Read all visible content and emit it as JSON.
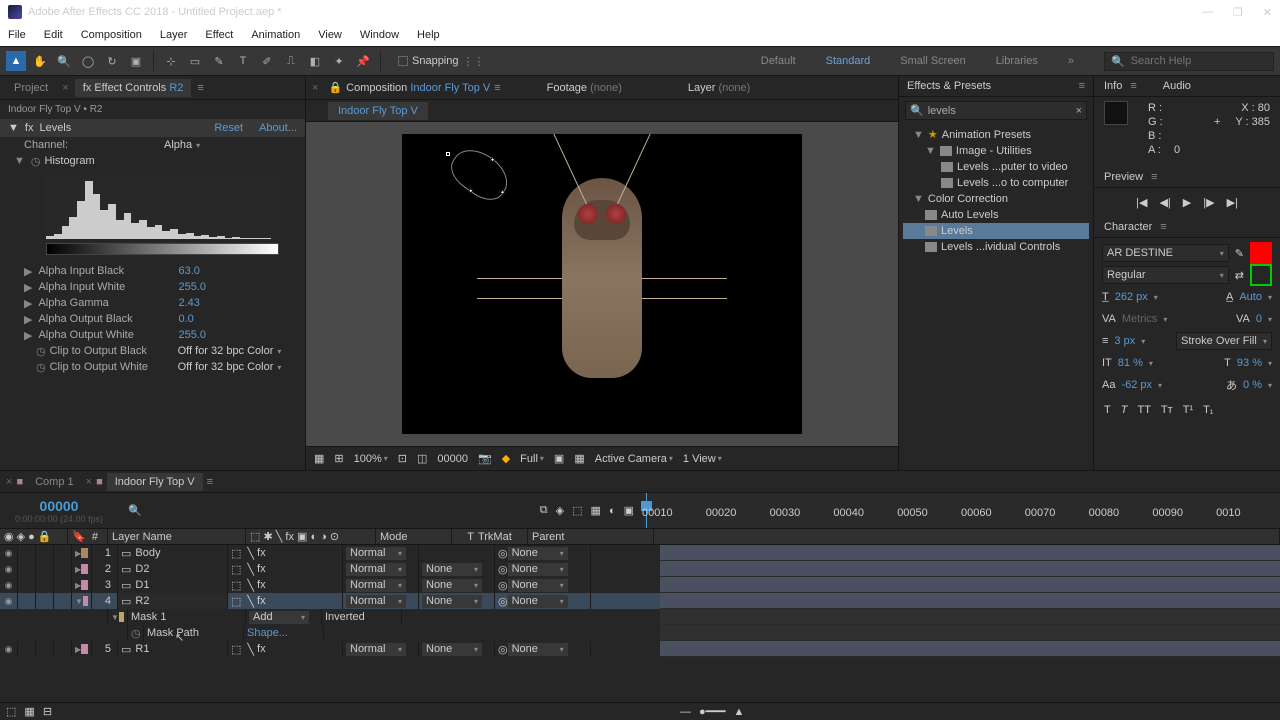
{
  "title": "Adobe After Effects CC 2018 - Untitled Project.aep *",
  "menu": [
    "File",
    "Edit",
    "Composition",
    "Layer",
    "Effect",
    "Animation",
    "View",
    "Window",
    "Help"
  ],
  "toolbar": {
    "snapping": "Snapping",
    "workspace": {
      "default": "Default",
      "standard": "Standard",
      "small": "Small Screen",
      "libs": "Libraries"
    },
    "searchPlaceholder": "Search Help"
  },
  "left": {
    "tabs": {
      "project": "Project",
      "ec": "Effect Controls",
      "ecTarget": "R2"
    },
    "path": "Indoor Fly Top V • R2",
    "fx": {
      "name": "Levels",
      "reset": "Reset",
      "about": "About...",
      "channel_lbl": "Channel:",
      "channel_val": "Alpha",
      "histogram": "Histogram"
    },
    "params": [
      {
        "lbl": "Alpha Input Black",
        "val": "63.0"
      },
      {
        "lbl": "Alpha Input White",
        "val": "255.0"
      },
      {
        "lbl": "Alpha Gamma",
        "val": "2.43"
      },
      {
        "lbl": "Alpha Output Black",
        "val": "0.0"
      },
      {
        "lbl": "Alpha Output White",
        "val": "255.0"
      }
    ],
    "clip": [
      {
        "lbl": "Clip to Output Black",
        "val": "Off for 32 bpc Color"
      },
      {
        "lbl": "Clip to Output White",
        "val": "Off for 32 bpc Color"
      }
    ]
  },
  "center": {
    "tabs": {
      "comp": "Composition",
      "compName": "Indoor Fly Top V",
      "footage": "Footage",
      "footageVal": "(none)",
      "layer": "Layer",
      "layerVal": "(none)"
    },
    "subtab": "Indoor Fly Top V",
    "ctrl": {
      "zoom": "100%",
      "time": "00000",
      "res": "Full",
      "cam": "Active Camera",
      "view": "1 View"
    }
  },
  "ep": {
    "title": "Effects & Presets",
    "search": "levels",
    "nodes": {
      "ap": "Animation Presets",
      "iu": "Image - Utilities",
      "l1": "Levels ...puter to video",
      "l2": "Levels ...o to computer",
      "cc": "Color Correction",
      "al": "Auto Levels",
      "lv": "Levels",
      "lic": "Levels ...ividual Controls"
    }
  },
  "info": {
    "title": "Info",
    "audio": "Audio",
    "r": "R :",
    "g": "G :",
    "b": "B :",
    "a": "A :",
    "aval": "0",
    "x": "X : 80",
    "y": "Y : 385",
    "plus": "+"
  },
  "preview": {
    "title": "Preview"
  },
  "char": {
    "title": "Character",
    "font": "AR DESTINE",
    "weight": "Regular",
    "size": "262 px",
    "auto": "Auto",
    "kerning": "0",
    "leading": "3 px",
    "stroke": "Stroke Over Fill",
    "vscale": "81 %",
    "hscale": "93 %",
    "baseline": "-62 px",
    "tsume": "0 %"
  },
  "tl": {
    "tabs": {
      "comp1": "Comp 1",
      "fly": "Indoor Fly Top V"
    },
    "timecode": "00000",
    "sub": "0:00:00:00 (24.00 fps)",
    "cols": {
      "num": "#",
      "name": "Layer Name",
      "mode": "Mode",
      "trk": "TrkMat",
      "parent": "Parent"
    },
    "ticks": [
      "00010",
      "00020",
      "00030",
      "00040",
      "00050",
      "00060",
      "00070",
      "00080",
      "00090",
      "0010"
    ],
    "rows": [
      {
        "n": "1",
        "name": "Body",
        "mode": "Normal",
        "trk": "",
        "parent": "None"
      },
      {
        "n": "2",
        "name": "D2",
        "mode": "Normal",
        "trk": "None",
        "parent": "None"
      },
      {
        "n": "3",
        "name": "D1",
        "mode": "Normal",
        "trk": "None",
        "parent": "None"
      },
      {
        "n": "4",
        "name": "R2",
        "mode": "Normal",
        "trk": "None",
        "parent": "None",
        "sel": true
      },
      {
        "n": "5",
        "name": "R1",
        "mode": "Normal",
        "trk": "None",
        "parent": "None"
      }
    ],
    "mask": {
      "name": "Mask 1",
      "mode": "Add",
      "inv": "Inverted",
      "path": "Mask Path",
      "shape": "Shape..."
    }
  }
}
